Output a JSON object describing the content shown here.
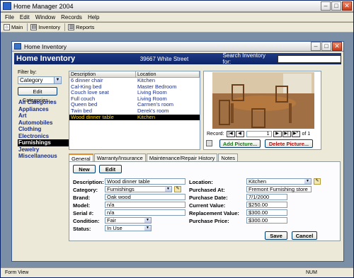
{
  "app": {
    "title": "Home Manager 2004"
  },
  "menu": [
    "File",
    "Edit",
    "Window",
    "Records",
    "Help"
  ],
  "toolbar": [
    {
      "label": "Main",
      "icon": "home-icon"
    },
    {
      "label": "Inventory",
      "icon": "inventory-icon"
    },
    {
      "label": "Reports",
      "icon": "reports-icon"
    }
  ],
  "doc": {
    "title": "Home Inventory"
  },
  "header": {
    "title": "Home Inventory",
    "address": "39667 White Street",
    "search_label": "Search Inventory for:",
    "search_value": ""
  },
  "filter": {
    "label": "Filter by:",
    "value": "Category",
    "edit_label": "Edit Categories..."
  },
  "categories": [
    {
      "label": "All Categories",
      "selected": false
    },
    {
      "label": "Appliances",
      "selected": false
    },
    {
      "label": "Art",
      "selected": false
    },
    {
      "label": "Automobiles",
      "selected": false
    },
    {
      "label": "Clothing",
      "selected": false
    },
    {
      "label": "Electronics",
      "selected": false
    },
    {
      "label": "Furnishings",
      "selected": true
    },
    {
      "label": "Jewelry",
      "selected": false
    },
    {
      "label": "Miscellaneous",
      "selected": false
    }
  ],
  "list": {
    "columns": [
      "Description",
      "Location"
    ],
    "rows": [
      {
        "description": "6 dinner chair",
        "location": "Kitchen",
        "selected": false
      },
      {
        "description": "Cal-King bed",
        "location": "Master Bedroom",
        "selected": false
      },
      {
        "description": "Couch love seat",
        "location": "Living Room",
        "selected": false
      },
      {
        "description": "Full couch",
        "location": "Living Room",
        "selected": false
      },
      {
        "description": "Queen bed",
        "location": "Carmen's room",
        "selected": false
      },
      {
        "description": "Twin bed",
        "location": "Derek's room",
        "selected": false
      },
      {
        "description": "Wood dinner table",
        "location": "Kitchen",
        "selected": true
      }
    ]
  },
  "record": {
    "label": "Record:",
    "current": "1",
    "of_label": "of 1"
  },
  "picture": {
    "add_label": "Add Picture...",
    "delete_label": "Delete Picture..."
  },
  "tabs": [
    "General",
    "Warranty/Insurance",
    "Maintenance/Repair History",
    "Notes"
  ],
  "form": {
    "new_label": "New",
    "edit_label": "Edit",
    "description_label": "Description:",
    "description": "Wood dinner table",
    "category_label": "Category:",
    "category": "Furnishings",
    "brand_label": "Brand:",
    "brand": "Oak wood",
    "model_label": "Model:",
    "model": "n/a",
    "serial_label": "Serial #:",
    "serial": "n/a",
    "condition_label": "Condition:",
    "condition": "Fair",
    "status_label": "Status:",
    "status": "In Use",
    "location_label": "Location:",
    "location": "Kitchen",
    "purchased_at_label": "Purchased At:",
    "purchased_at": "Fremont Furnishing store",
    "purchase_date_label": "Purchase Date:",
    "purchase_date": "7/1/2000",
    "current_value_label": "Current Value:",
    "current_value": "$250.00",
    "replacement_value_label": "Replacement Value:",
    "replacement_value": "$300.00",
    "purchase_price_label": "Purchase Price:",
    "purchase_price": "$300.00",
    "save_label": "Save",
    "cancel_label": "Cancel"
  },
  "status": {
    "left": "Form View",
    "right": "NUM"
  },
  "colors": {
    "header_bg": "#0c2368",
    "selection_bg": "#000000",
    "selection_fg": "#ffd800",
    "accent_link": "#1a2e88"
  }
}
